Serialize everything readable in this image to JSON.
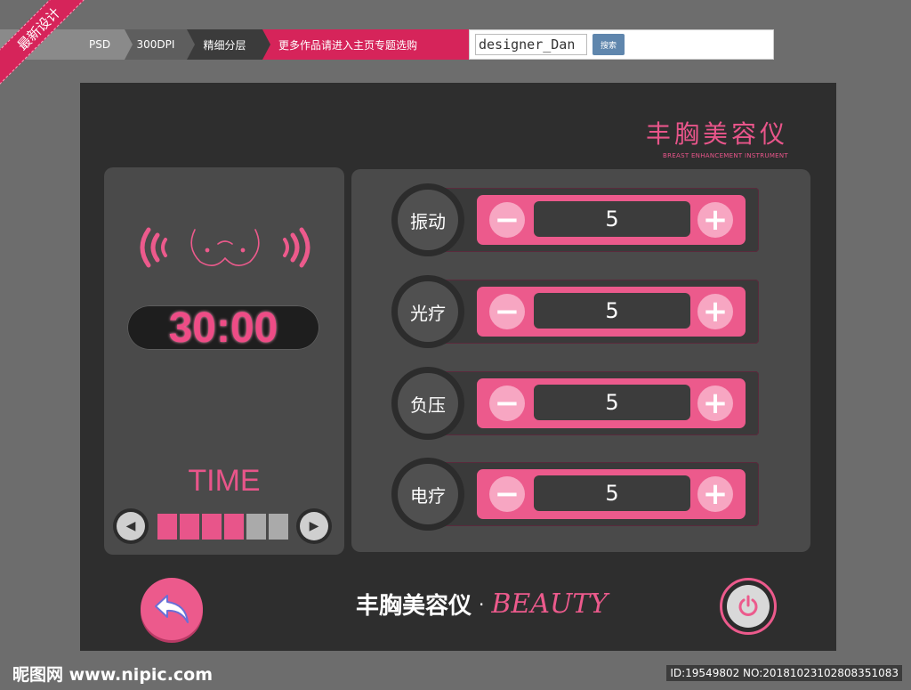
{
  "ribbon": {
    "label": "最新设计"
  },
  "breadcrumb": {
    "items": [
      "PSD",
      "300DPI",
      "精细分层",
      "更多作品请进入主页专题选购"
    ]
  },
  "search": {
    "value": "designer_Dan",
    "button_label": "搜索"
  },
  "brand": {
    "title": "丰胸美容仪",
    "subtitle": "BREAST ENHANCEMENT INSTRUMENT"
  },
  "timer": {
    "display": "30:00"
  },
  "time_control": {
    "label": "TIME",
    "prev_icon": "triangle-left",
    "next_icon": "triangle-right",
    "level": 4,
    "levels_total": 6
  },
  "controls": [
    {
      "label": "振动",
      "value": "5",
      "minus": "−",
      "plus": "+"
    },
    {
      "label": "光疗",
      "value": "5",
      "minus": "−",
      "plus": "+"
    },
    {
      "label": "负压",
      "value": "5",
      "minus": "−",
      "plus": "+"
    },
    {
      "label": "电疗",
      "value": "5",
      "minus": "−",
      "plus": "+"
    }
  ],
  "footer": {
    "title_cn": "丰胸美容仪",
    "separator": "·",
    "title_en": "BEAUTY"
  },
  "watermark": {
    "site": "昵图网 www.nipic.com",
    "id": "ID:19549802 NO:20181023102808351083"
  },
  "colors": {
    "accent": "#ec5a8c",
    "panel": "#2e2e2e",
    "card": "#4a4a4a",
    "background": "#6d6d6d"
  }
}
